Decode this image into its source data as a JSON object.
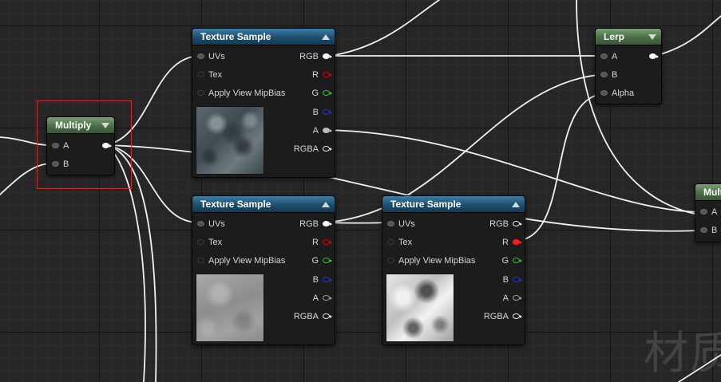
{
  "nodes": {
    "multiply_main": {
      "title": "Multiply",
      "inputs": [
        {
          "label": "A"
        },
        {
          "label": "B"
        }
      ]
    },
    "lerp": {
      "title": "Lerp",
      "inputs": [
        {
          "label": "A"
        },
        {
          "label": "B"
        },
        {
          "label": "Alpha"
        }
      ]
    },
    "multiply_right": {
      "title": "Mult",
      "inputs": [
        {
          "label": "A"
        },
        {
          "label": "B"
        }
      ]
    },
    "texture_sample_top": {
      "title": "Texture Sample",
      "inputs": [
        {
          "label": "UVs"
        },
        {
          "label": "Tex"
        },
        {
          "label": "Apply View MipBias"
        }
      ],
      "outputs": [
        {
          "label": "RGB"
        },
        {
          "label": "R"
        },
        {
          "label": "G"
        },
        {
          "label": "B"
        },
        {
          "label": "A"
        },
        {
          "label": "RGBA"
        }
      ],
      "thumbnail": "dark-rock-texture"
    },
    "texture_sample_bottom_left": {
      "title": "Texture Sample",
      "inputs": [
        {
          "label": "UVs"
        },
        {
          "label": "Tex"
        },
        {
          "label": "Apply View MipBias"
        }
      ],
      "outputs": [
        {
          "label": "RGB"
        },
        {
          "label": "R"
        },
        {
          "label": "G"
        },
        {
          "label": "B"
        },
        {
          "label": "A"
        },
        {
          "label": "RGBA"
        }
      ],
      "thumbnail": "grey-concrete-texture"
    },
    "texture_sample_bottom_right": {
      "title": "Texture Sample",
      "inputs": [
        {
          "label": "UVs"
        },
        {
          "label": "Tex"
        },
        {
          "label": "Apply View MipBias"
        }
      ],
      "outputs": [
        {
          "label": "RGB"
        },
        {
          "label": "R"
        },
        {
          "label": "G"
        },
        {
          "label": "B"
        },
        {
          "label": "A"
        },
        {
          "label": "RGBA"
        }
      ],
      "thumbnail": "cloud-noise-texture"
    }
  },
  "watermark": "材质",
  "colors": {
    "background": "#262626",
    "texture_header": "#1d4f6e",
    "math_header": "#4b6d47",
    "wire": "#f0f0f0",
    "selection": "#c83232",
    "pin_red": "#e00000",
    "pin_green": "#20d020",
    "pin_blue": "#1a30ff"
  }
}
